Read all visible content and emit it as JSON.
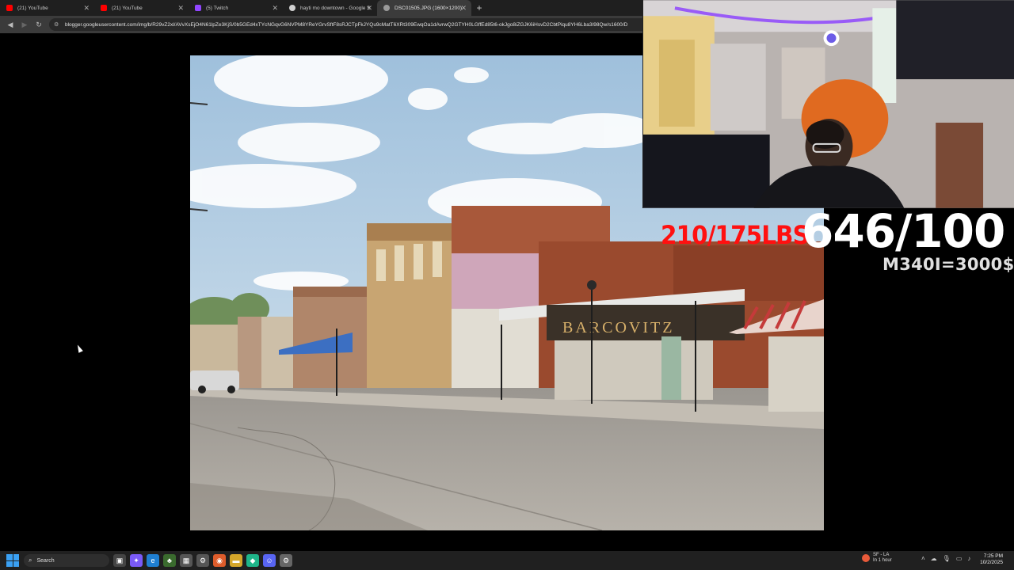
{
  "browser": {
    "tabs": [
      {
        "title": "(21) YouTube",
        "favicon": "youtube-icon",
        "color": "#ff0000"
      },
      {
        "title": "(21) YouTube",
        "favicon": "youtube-icon",
        "color": "#ff0000"
      },
      {
        "title": "(5) Twitch",
        "favicon": "twitch-icon",
        "color": "#9146ff"
      },
      {
        "title": "hayti mo downtown - Google S",
        "favicon": "google-icon",
        "color": "#cfcfcf"
      },
      {
        "title": "DSC01505.JPG (1600×1200)",
        "favicon": "globe-icon",
        "color": "#9a9a9a"
      }
    ],
    "active_tab": 4,
    "new_tab": "+",
    "url": "blogger.googleusercontent.com/img/b/R29vZ2xl/AVvXsEjO4N61lpZe3KjS/0b5GEd4xTYcNGqvG6NVPM8YReYGrvSftF8sRJCTpFkJYQu9cMatT6XRt309EwqOa1dAvrwQ2GTYH0LGffEd85t6-okJgo8iZGJK6iHsvD2CbtPiqu8YH6Lba3I98Qw/s1600/D"
  },
  "overlay": {
    "weight": "210/175LBS",
    "progress": "646/100",
    "goal": "M340I=3000$",
    "weight_color": "#ff1010"
  },
  "taskbar": {
    "search_label": "Search",
    "weather_temp": "SF - LA",
    "weather_sub": "In 1 hour",
    "time": "7:25 PM",
    "date": "10/2/2025"
  }
}
